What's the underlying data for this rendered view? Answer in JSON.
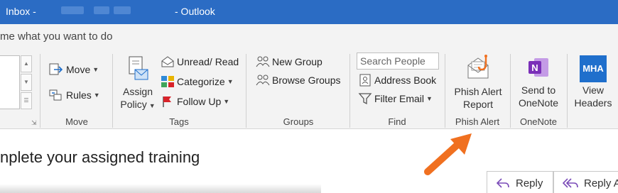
{
  "titlebar": {
    "inbox": "Inbox -",
    "app": "- Outlook"
  },
  "tell_me": {
    "text": "me what you want to do"
  },
  "ribbon": {
    "move_group": {
      "move_label": "Move",
      "rules_label": "Rules",
      "group_label": "Move"
    },
    "tags_group": {
      "assign_policy_line1": "Assign",
      "assign_policy_line2": "Policy",
      "unread_read": "Unread/ Read",
      "categorize": "Categorize",
      "follow_up": "Follow Up",
      "group_label": "Tags"
    },
    "groups_group": {
      "new_group": "New Group",
      "browse_groups": "Browse Groups",
      "group_label": "Groups"
    },
    "find_group": {
      "search_placeholder": "Search People",
      "address_book": "Address Book",
      "filter_email": "Filter Email",
      "group_label": "Find"
    },
    "phish_group": {
      "line1": "Phish Alert",
      "line2": "Report",
      "group_label": "Phish Alert"
    },
    "onenote_group": {
      "line1": "Send to",
      "line2": "OneNote",
      "group_label": "OneNote"
    },
    "mha_group": {
      "icon_text": "MHA",
      "line1": "View",
      "line2": "Headers"
    }
  },
  "message": {
    "subject": "nplete your assigned training",
    "reply": "Reply",
    "reply_all": "Reply Al"
  },
  "colors": {
    "title_bar": "#2b6cc4",
    "arrow": "#f07020",
    "onenote": "#7a2fb8",
    "mha": "#1f6fcc",
    "flag": "#d8232a"
  }
}
